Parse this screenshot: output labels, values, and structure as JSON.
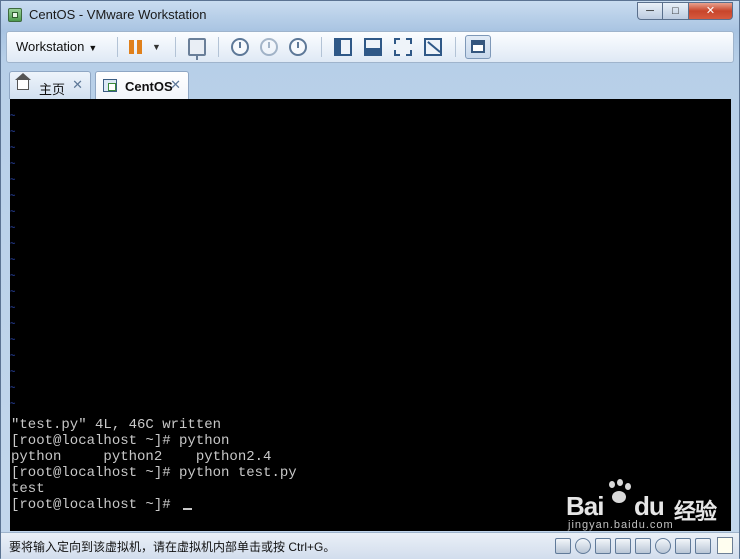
{
  "window": {
    "title": "CentOS - VMware Workstation",
    "controls": {
      "minimize": "─",
      "maximize": "□",
      "close": "✕"
    }
  },
  "toolbar": {
    "menu_label": "Workstation",
    "menu_caret": "▼",
    "pause_caret": "▼"
  },
  "tabs": [
    {
      "label": "主页",
      "close": "✕",
      "icon": "home-icon",
      "active": false
    },
    {
      "label": "CentOS",
      "close": "✕",
      "icon": "vm-icon",
      "active": true
    }
  ],
  "console": {
    "tilde_glyph": "~",
    "tilde_count": 19,
    "lines": [
      "\"test.py\" 4L, 46C written",
      "[root@localhost ~]# python",
      "python     python2    python2.4",
      "[root@localhost ~]# python test.py",
      "test",
      "[root@localhost ~]# "
    ]
  },
  "watermark": {
    "bai": "Bai",
    "du": "du",
    "jingyan": "经验",
    "sub": "jingyan.baidu.com"
  },
  "statusbar": {
    "text": "要将输入定向到该虚拟机，请在虚拟机内部单击或按 Ctrl+G。"
  },
  "colors": {
    "console_bg": "#000000",
    "console_text": "#c8c8c8",
    "tilde": "#2f4fc0",
    "pause": "#e0801b"
  }
}
